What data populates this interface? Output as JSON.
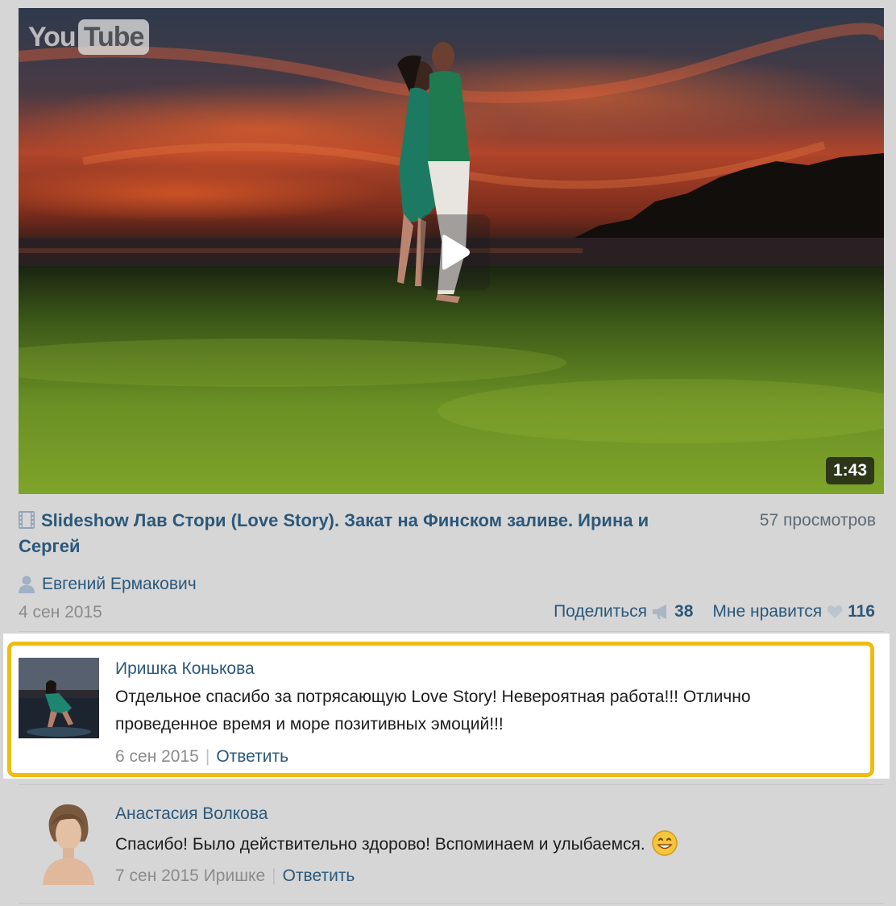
{
  "video": {
    "logo_you": "You",
    "logo_tube": "Tube",
    "duration": "1:43",
    "play_icon": "play-icon",
    "title": "Slideshow Лав Стори (Love Story). Закат на Финском заливе. Ирина и Сергей",
    "views": "57 просмотров",
    "author": "Евгений Ермакович",
    "date": "4 сен 2015",
    "share_label": "Поделиться",
    "share_count": "38",
    "like_label": "Мне нравится",
    "like_count": "116"
  },
  "comments": [
    {
      "author": "Иришка Конькова",
      "text": "Отдельное спасибо за потрясающую Love Story! Невероятная работа!!! Отлично проведенное время и море позитивных эмоций!!!",
      "date": "6 сен 2015",
      "reply_label": "Ответить",
      "highlighted": true
    },
    {
      "author": "Анастасия Волкова",
      "text": "Спасибо! Было действительно здорово! Вспоминаем и улыбаемся.",
      "date": "7 сен 2015",
      "reply_to": "Иришке",
      "reply_label": "Ответить",
      "emoji": "smile-emoji-icon"
    }
  ],
  "colors": {
    "link": "#2b587a",
    "highlight_border": "#eebd10",
    "background": "#d6d6d6"
  }
}
